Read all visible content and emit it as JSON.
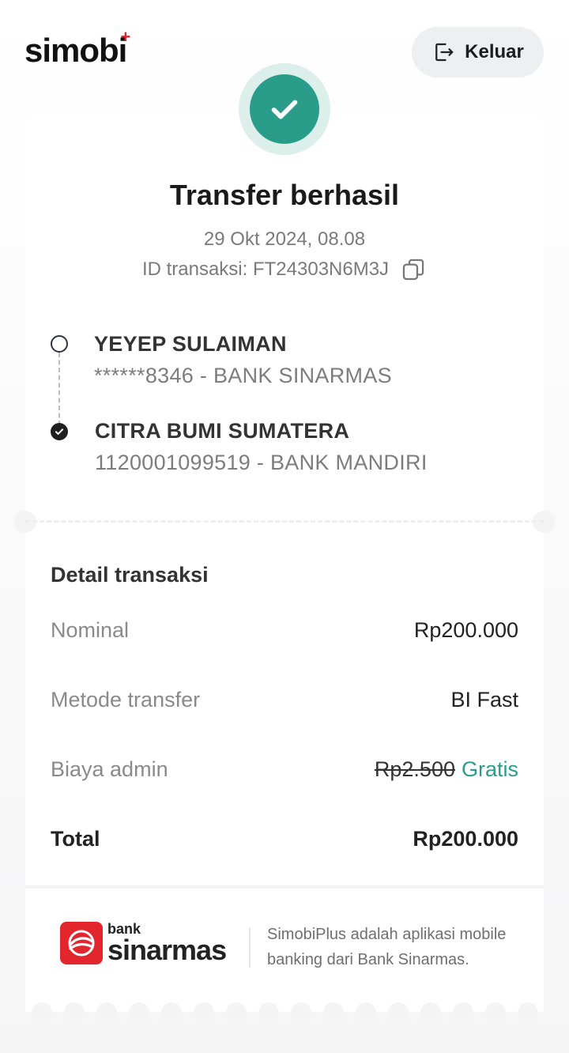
{
  "app": {
    "logo_text": "simobi",
    "logo_plus": "+"
  },
  "header": {
    "logout_label": "Keluar",
    "logout_icon": "logout-icon"
  },
  "receipt": {
    "status_icon": "check-icon",
    "title": "Transfer berhasil",
    "date": "29 Okt 2024, 08.08",
    "transaction_id": "ID transaksi: FT24303N6M3J",
    "sender": {
      "name": "YEYEP SULAIMAN",
      "account": "******8346 - BANK SINARMAS"
    },
    "recipient": {
      "name": "CITRA BUMI SUMATERA",
      "account": "1120001099519 - BANK MANDIRI"
    }
  },
  "details": {
    "heading": "Detail transaksi",
    "nominal_label": "Nominal",
    "nominal_value": "Rp200.000",
    "method_label": "Metode transfer",
    "method_value": "BI Fast",
    "fee_label": "Biaya admin",
    "fee_original": "Rp2.500",
    "fee_value": "Gratis",
    "total_label": "Total",
    "total_value": "Rp200.000"
  },
  "footer": {
    "bank_word1": "bank",
    "bank_word2": "sinarmas",
    "description": "SimobiPlus adalah aplikasi mobile banking dari Bank Sinarmas."
  },
  "colors": {
    "accent": "#2a9d8a",
    "brand_red": "#e3262e"
  }
}
